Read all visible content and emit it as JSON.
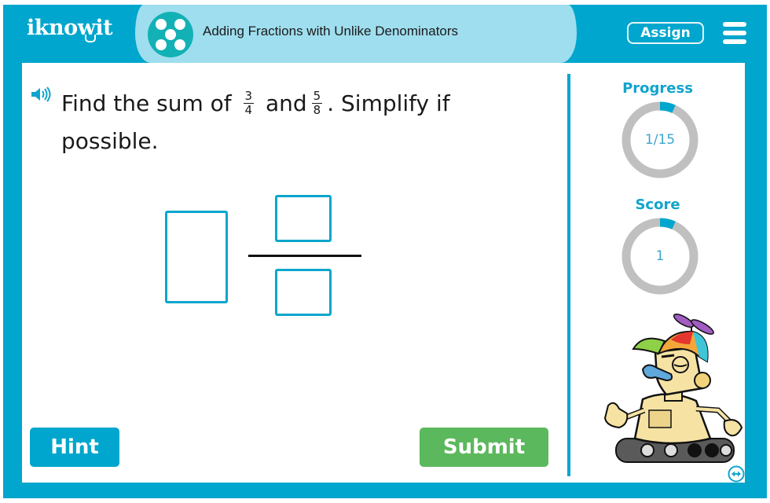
{
  "header": {
    "logo_text": "iknowit",
    "title": "Adding Fractions with Unlike Denominators",
    "assign_label": "Assign",
    "topic_icon": "five-dots-icon",
    "menu_icon": "hamburger-menu-icon"
  },
  "question": {
    "audio_icon": "speaker-icon",
    "prefix": "Find the sum of",
    "fraction1": {
      "numerator": "3",
      "denominator": "4"
    },
    "middle": "and",
    "fraction2": {
      "numerator": "5",
      "denominator": "8"
    },
    "suffix": ". Simplify if possible."
  },
  "answer": {
    "whole_value": "",
    "numerator_value": "",
    "denominator_value": ""
  },
  "buttons": {
    "hint_label": "Hint",
    "submit_label": "Submit"
  },
  "sidebar": {
    "progress_label": "Progress",
    "progress_value": "1/15",
    "progress_fraction": 0.0667,
    "score_label": "Score",
    "score_value": "1",
    "score_fraction": 0.0667,
    "mascot": "robot-mascot",
    "expand_icon": "expand-horizontal-icon"
  },
  "colors": {
    "brand_blue": "#00a6cd",
    "title_pill": "#9fdeee",
    "topic_icon": "#12b1b5",
    "submit_green": "#5cb85c",
    "ring_track": "#c0c0c0",
    "ring_fill": "#00a6cd"
  }
}
